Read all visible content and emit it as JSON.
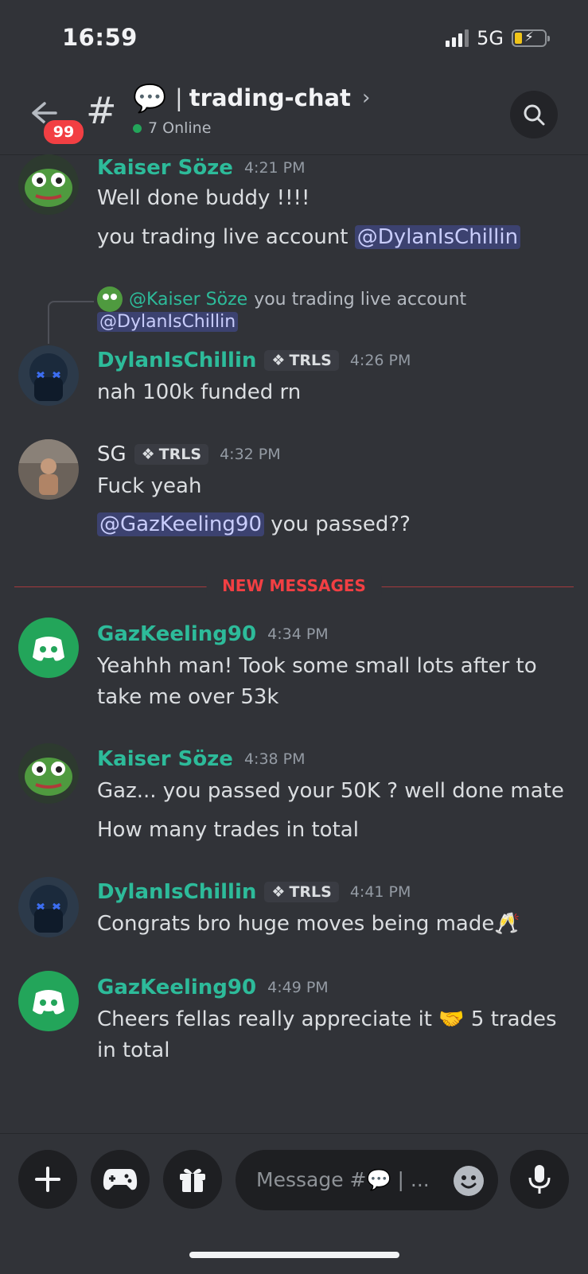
{
  "status": {
    "time": "16:59",
    "network": "5G"
  },
  "header": {
    "badge": "99",
    "hash": "#",
    "channel_emoji": "💬",
    "channel_name": "trading-chat",
    "online": "7 Online",
    "back_icon": "back-arrow-icon",
    "search_icon": "search-icon"
  },
  "messages": [
    {
      "author": "Kaiser Söze",
      "time": "4:21 PM",
      "lines": [
        "Well done buddy !!!!"
      ],
      "line2_text": "you trading live account ",
      "line2_mention": "@DylanIsChillin"
    },
    {
      "reply_name": "@Kaiser Söze",
      "reply_text": "you trading live account",
      "reply_mention": "@DylanIsChillin",
      "author": "DylanIsChillin",
      "tag": "TRLS",
      "time": "4:26 PM",
      "text": "nah 100k funded rn"
    },
    {
      "author": "SG",
      "tag": "TRLS",
      "time": "4:32 PM",
      "text": "Fuck yeah",
      "mention": "@GazKeeling90",
      "mention_after": " you passed??"
    },
    {
      "author": "GazKeeling90",
      "time": "4:34 PM",
      "line1": "Yeahhh man! Took some small lots after to",
      "line2": "take me over 53k"
    },
    {
      "author": "Kaiser Söze",
      "time": "4:38 PM",
      "line1": "Gaz... you passed your 50K ? well done mate",
      "line2": "How many trades in total"
    },
    {
      "author": "DylanIsChillin",
      "tag": "TRLS",
      "time": "4:41 PM",
      "text": "Congrats bro huge moves being made🥂"
    },
    {
      "author": "GazKeeling90",
      "time": "4:49 PM",
      "line1": "Cheers fellas really appreciate it 🤝 5 trades",
      "line2": "in total"
    }
  ],
  "divider": "NEW MESSAGES",
  "composer": {
    "placeholder": "Message #💬 | ..."
  },
  "colors": {
    "background": "#313338",
    "username": "#2dbb9a",
    "mention_bg": "#3c4270",
    "new_messages": "#f23f43",
    "online": "#23a55a"
  }
}
